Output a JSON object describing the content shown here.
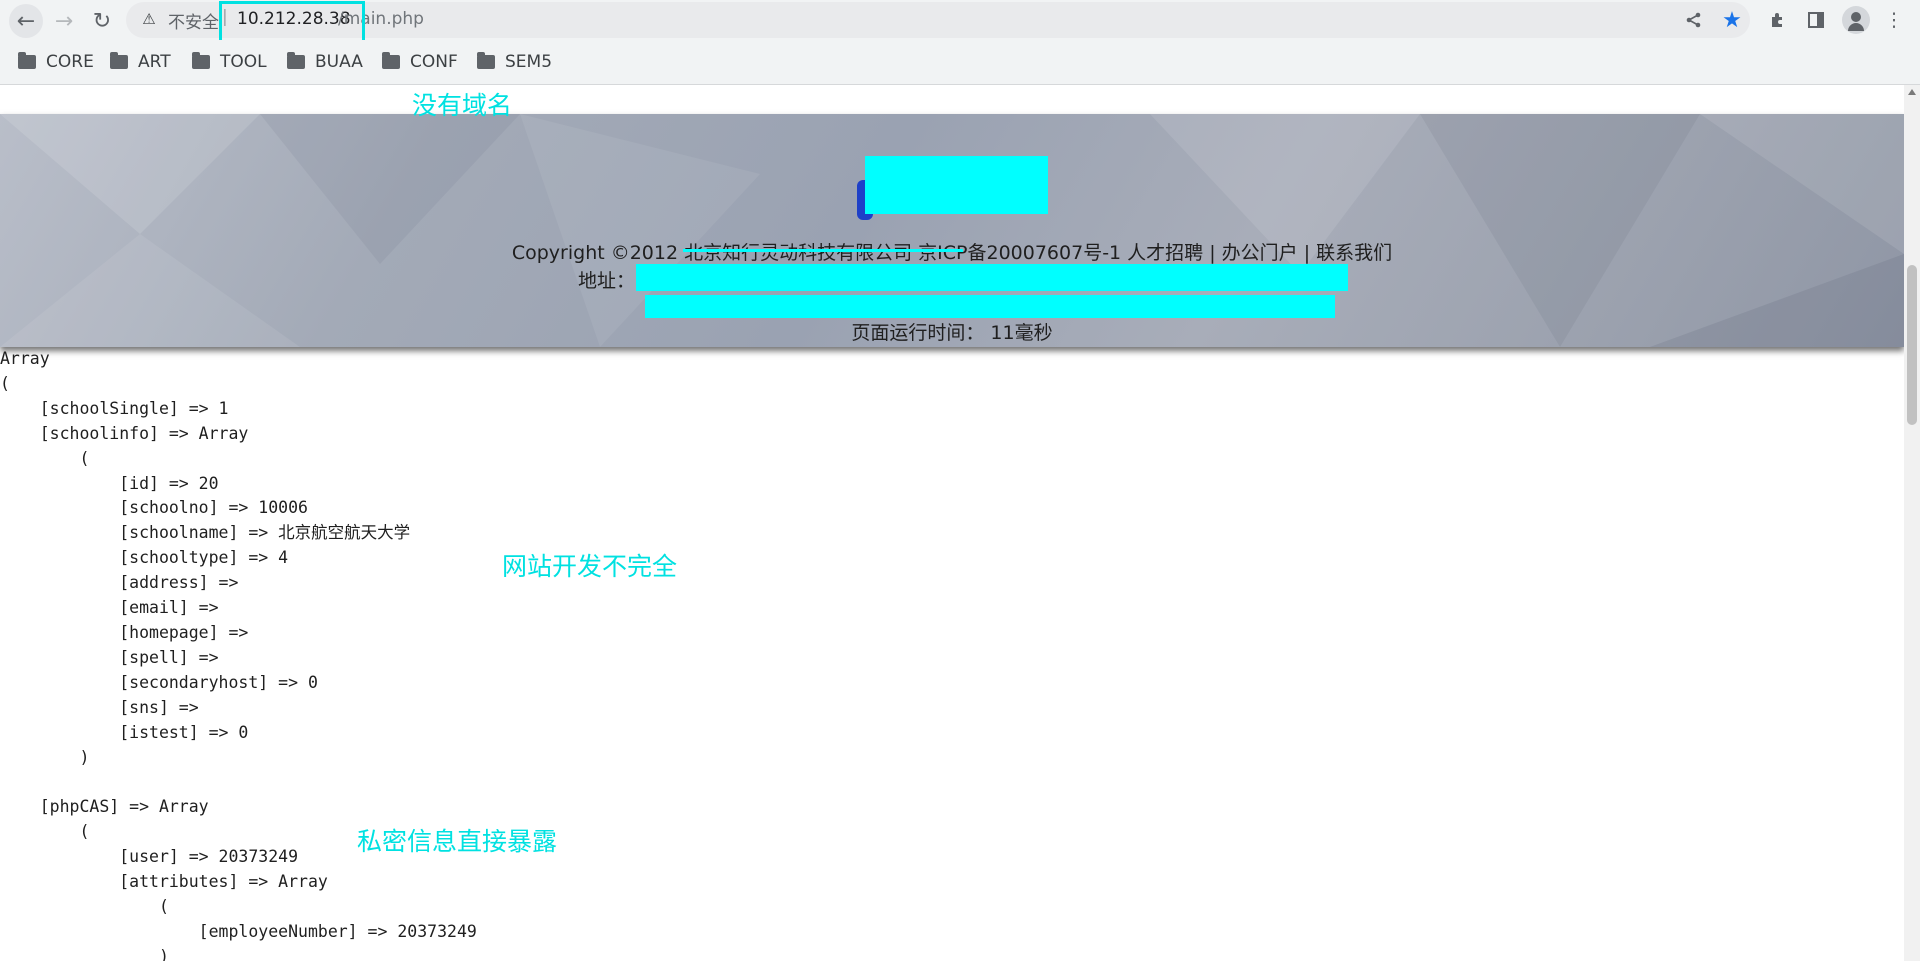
{
  "browser": {
    "security_label": "不安全",
    "url_host": "10.212.28.38",
    "url_path": "/main.php",
    "icons": [
      "arrow-left-icon",
      "arrow-right-icon",
      "reload-icon",
      "warning-icon",
      "share-icon",
      "star-icon",
      "extensions-icon",
      "side-panel-icon",
      "profile-icon",
      "more-menu-icon"
    ],
    "accent_color": "#1a73e8"
  },
  "bookmarks": [
    {
      "label": "CORE"
    },
    {
      "label": "ART"
    },
    {
      "label": "TOOL"
    },
    {
      "label": "BUAA"
    },
    {
      "label": "CONF"
    },
    {
      "label": "SEM5"
    }
  ],
  "footer": {
    "copyright": "Copyright ©2012 北京知行灵动科技有限公司 京ICP备20007607号-1 人才招聘 | 办公门户 | 联系我们",
    "address_label": "地址：",
    "runtime": "页面运行时间： 11毫秒",
    "redaction_color": "#00ffff"
  },
  "dump_lines": [
    "Array",
    "(",
    "    [schoolSingle] => 1",
    "    [schoolinfo] => Array",
    "        (",
    "            [id] => 20",
    "            [schoolno] => 10006",
    "            [schoolname] => 北京航空航天大学",
    "            [schooltype] => 4",
    "            [address] =>",
    "            [email] =>",
    "            [homepage] =>",
    "            [spell] =>",
    "            [secondaryhost] => 0",
    "            [sns] =>",
    "            [istest] => 0",
    "        )",
    "",
    "    [phpCAS] => Array",
    "        (",
    "            [user] => 20373249",
    "            [attributes] => Array",
    "                (",
    "                    [employeeNumber] => 20373249",
    "                )"
  ],
  "annotations": {
    "no_domain": "没有域名",
    "incomplete_dev": "网站开发不完全",
    "private_info": "私密信息直接暴露",
    "color": "#00e1e1"
  }
}
